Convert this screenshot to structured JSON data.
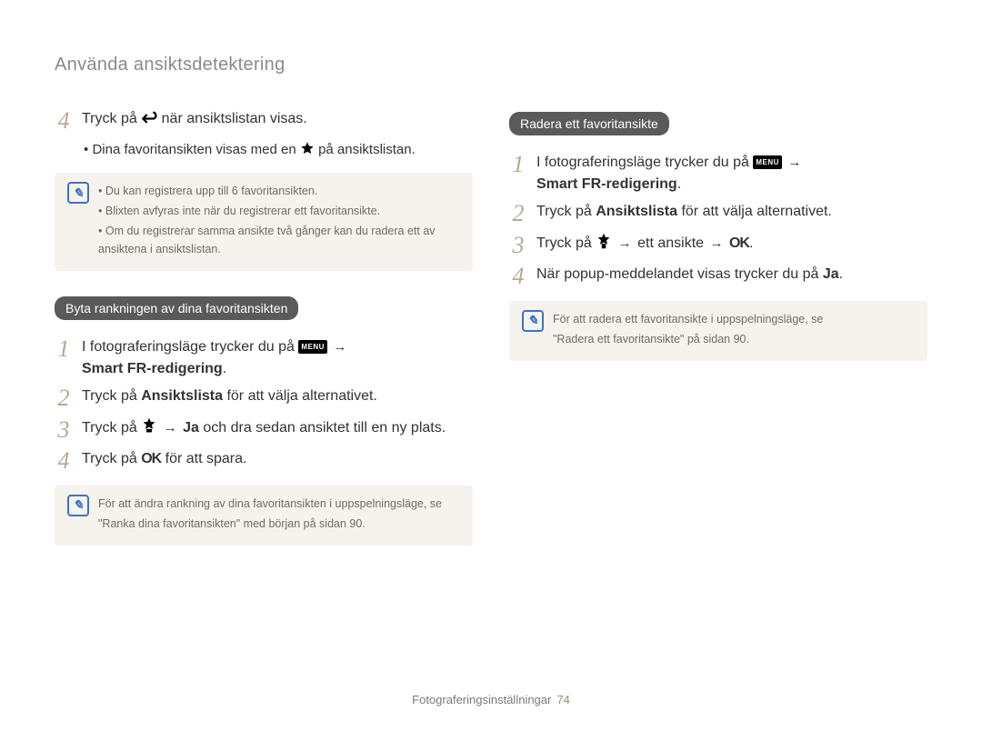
{
  "header": "Använda ansiktsdetektering",
  "left": {
    "step4": {
      "num": "4",
      "pre": "Tryck på ",
      "post": " när ansiktslistan visas."
    },
    "step4_sub": {
      "bullet": "•",
      "pre": "Dina favoritansikten visas med en ",
      "post": " på ansiktslistan."
    },
    "note1": {
      "b1": "Du kan registrera upp till 6 favoritansikten.",
      "b2": "Blixten avfyras inte när du registrerar ett favoritansikte.",
      "b3": "Om du registrerar samma ansikte två gånger kan du radera ett av ansiktena i ansiktslistan."
    },
    "chip1": "Byta rankningen av dina favoritansikten",
    "s1": {
      "num": "1",
      "pre": "I fotograferingsläge trycker du på ",
      "arrow": "→",
      "bold": "Smart FR-redigering",
      "dot": "."
    },
    "s2": {
      "num": "2",
      "pre": "Tryck på ",
      "bold": "Ansiktslista",
      "post": " för att välja alternativet."
    },
    "s3": {
      "num": "3",
      "pre": "Tryck på ",
      "arrow1": "→",
      "bold": "Ja",
      "post": " och dra sedan ansiktet till en ny plats."
    },
    "s4": {
      "num": "4",
      "pre": "Tryck på ",
      "ok": "OK",
      "post": " för att spara."
    },
    "note2": {
      "line1": "För att ändra rankning av dina favoritansikten i uppspelningsläge, se",
      "line2": "\"Ranka dina favoritansikten\" med början på sidan 90."
    }
  },
  "right": {
    "chip": "Radera ett favoritansikte",
    "s1": {
      "num": "1",
      "pre": "I fotograferingsläge trycker du på ",
      "arrow": "→",
      "bold": "Smart FR-redigering",
      "dot": "."
    },
    "s2": {
      "num": "2",
      "pre": "Tryck på ",
      "bold": "Ansiktslista",
      "post": " för att välja alternativet."
    },
    "s3": {
      "num": "3",
      "pre": "Tryck på ",
      "arrow1": "→",
      "mid": " ett ansikte ",
      "arrow2": "→",
      "ok": "OK",
      "dot": "."
    },
    "s4": {
      "num": "4",
      "pre": "När popup-meddelandet visas trycker du på ",
      "bold": "Ja",
      "dot": "."
    },
    "note": {
      "line1": "För att radera ett favoritansikte i uppspelningsläge, se",
      "line2": "\"Radera ett favoritansikte\" på sidan 90."
    }
  },
  "footer": {
    "label": "Fotograferingsinställningar",
    "page": "74"
  }
}
